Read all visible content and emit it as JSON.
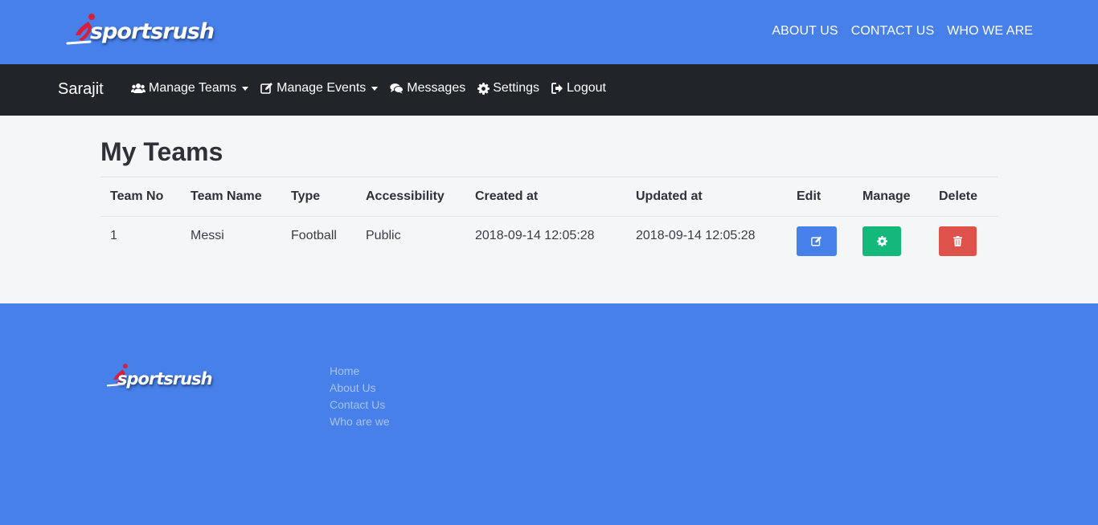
{
  "header": {
    "logo_text": "sportsrush",
    "nav": [
      {
        "label": "ABOUT US"
      },
      {
        "label": "CONTACT US"
      },
      {
        "label": "WHO WE ARE"
      }
    ]
  },
  "navbar": {
    "brand": "Sarajit",
    "items": [
      {
        "label": "Manage Teams",
        "icon": "users-icon",
        "dropdown": true
      },
      {
        "label": "Manage Events",
        "icon": "edit-icon",
        "dropdown": true
      },
      {
        "label": "Messages",
        "icon": "comments-icon",
        "dropdown": false
      },
      {
        "label": "Settings",
        "icon": "gear-icon",
        "dropdown": false
      },
      {
        "label": "Logout",
        "icon": "sign-out-icon",
        "dropdown": false
      }
    ]
  },
  "main": {
    "title": "My Teams",
    "table": {
      "columns": [
        "Team No",
        "Team Name",
        "Type",
        "Accessibility",
        "Created at",
        "Updated at",
        "Edit",
        "Manage",
        "Delete"
      ],
      "rows": [
        {
          "team_no": "1",
          "team_name": "Messi",
          "type": "Football",
          "accessibility": "Public",
          "created_at": "2018-09-14 12:05:28",
          "updated_at": "2018-09-14 12:05:28",
          "edit_icon": "edit-icon",
          "manage_icon": "gear-icon",
          "delete_icon": "trash-icon"
        }
      ]
    }
  },
  "footer": {
    "logo_text": "sportsrush",
    "links": [
      {
        "label": "Home"
      },
      {
        "label": "About Us"
      },
      {
        "label": "Contact Us"
      },
      {
        "label": "Who are we"
      }
    ]
  },
  "colors": {
    "primary": "#4680e8",
    "navbar": "#212529",
    "success": "#13b87a",
    "danger": "#de524b",
    "logo_red": "#d81e3a",
    "footer_link": "#a9c2f0"
  }
}
